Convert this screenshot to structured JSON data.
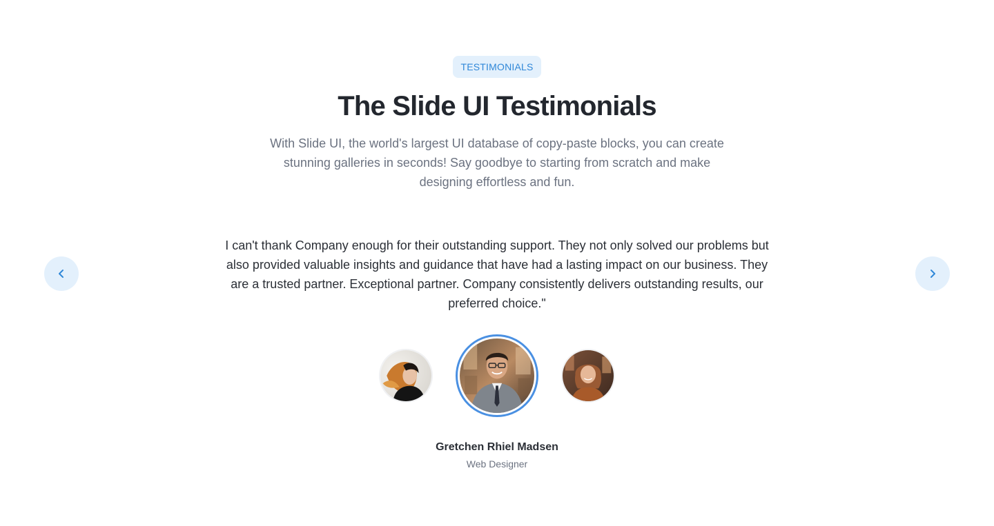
{
  "section": {
    "badge": "TESTIMONIALS",
    "title": "The Slide UI Testimonials",
    "subtitle": "With Slide UI, the world's largest UI database of copy-paste blocks, you can create stunning galleries in seconds! Say goodbye to starting from scratch and make designing effortless and fun."
  },
  "testimonial": {
    "quote": "I can't thank Company enough for their outstanding support. They not only solved our problems but also provided valuable insights and guidance that have had a lasting impact on our business. They are a trusted partner. Exceptional partner. Company consistently delivers outstanding results, our preferred choice.\"",
    "name": "Gretchen Rhiel Madsen",
    "role": "Web Designer"
  },
  "navigation": {
    "prev_icon": "chevron-left-icon",
    "next_icon": "chevron-right-icon"
  },
  "colors": {
    "accent": "#2f87d8",
    "accent_soft": "#e3f0fc",
    "active_ring": "#4a90e2"
  }
}
